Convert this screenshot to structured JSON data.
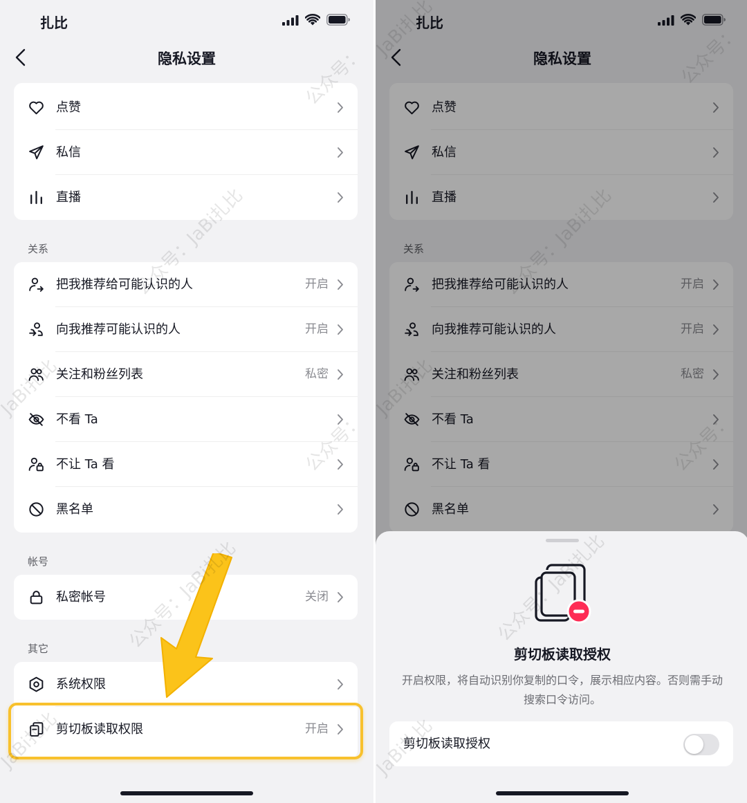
{
  "status_bar": {
    "carrier": "扎比"
  },
  "nav": {
    "title": "隐私设置"
  },
  "groups": {
    "top": [
      {
        "icon": "heart-icon",
        "label": "点赞",
        "value": ""
      },
      {
        "icon": "paper-plane-icon",
        "label": "私信",
        "value": ""
      },
      {
        "icon": "live-bars-icon",
        "label": "直播",
        "value": ""
      }
    ],
    "relations": {
      "header": "关系",
      "items": [
        {
          "icon": "user-share-icon",
          "label": "把我推荐给可能认识的人",
          "value": "开启"
        },
        {
          "icon": "user-recommend-icon",
          "label": "向我推荐可能认识的人",
          "value": "开启"
        },
        {
          "icon": "users-icon",
          "label": "关注和粉丝列表",
          "value": "私密"
        },
        {
          "icon": "eye-off-icon",
          "label": "不看 Ta",
          "value": ""
        },
        {
          "icon": "user-lock-icon",
          "label": "不让 Ta 看",
          "value": ""
        },
        {
          "icon": "block-icon",
          "label": "黑名单",
          "value": ""
        }
      ]
    },
    "account": {
      "header": "帐号",
      "items": [
        {
          "icon": "lock-icon",
          "label": "私密帐号",
          "value": "关闭"
        }
      ]
    },
    "other": {
      "header": "其它",
      "items": [
        {
          "icon": "hexagon-settings-icon",
          "label": "系统权限",
          "value": ""
        },
        {
          "icon": "clipboard-icon",
          "label": "剪切板读取权限",
          "value": "开启"
        }
      ]
    }
  },
  "sheet": {
    "title": "剪切板读取授权",
    "description": "开启权限，将自动识别你复制的口令，展示相应内容。否则需手动搜索口令访问。",
    "toggle_label": "剪切板读取授权",
    "toggle_on": false
  },
  "watermarks": [
    "JaBi扎比",
    "公众号：JaBi扎比",
    "公众号：",
    "JaBi扎比",
    "公众号：JaBi扎比",
    "公众号：",
    "JaBi扎比",
    "公众号：JaBi扎比",
    "公众号："
  ],
  "colors": {
    "highlight": "#f8c12d",
    "danger": "#fe2c55",
    "background": "#f2f2f4"
  }
}
